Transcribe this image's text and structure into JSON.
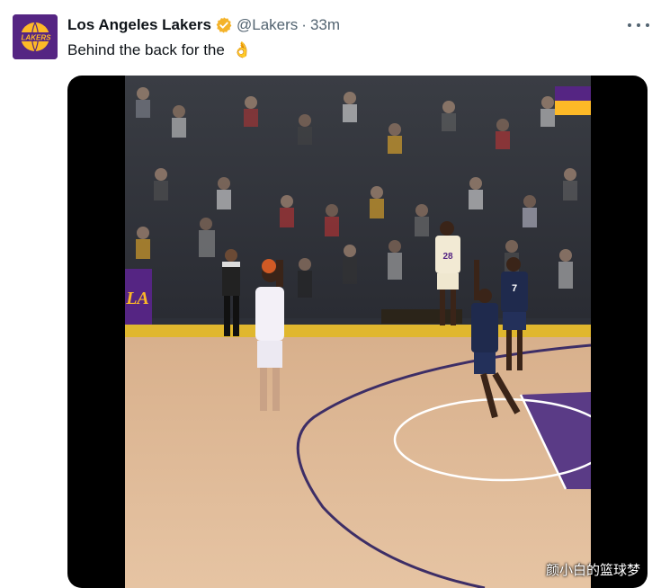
{
  "tweet": {
    "display_name": "Los Angeles Lakers",
    "handle": "@Lakers",
    "separator": "·",
    "time_ago": "33m",
    "text": "Behind the back for the",
    "emoji": "👌"
  },
  "avatar": {
    "logo_text": "LAKERS"
  },
  "video": {
    "brand_colors": {
      "purple": "#552583",
      "gold": "#fdb927"
    },
    "court_logo_text": "LA",
    "jersey_numbers": {
      "player_7": "7",
      "player_28": "28"
    },
    "watermark": "颜小白的篮球梦"
  },
  "colors": {
    "verified_badge": "#f4b32a",
    "text_secondary": "#536471",
    "lakers_purple": "#552583",
    "lakers_gold": "#fdb927"
  },
  "icons": {
    "verified": "verified-badge-icon",
    "more": "more-options-icon"
  }
}
